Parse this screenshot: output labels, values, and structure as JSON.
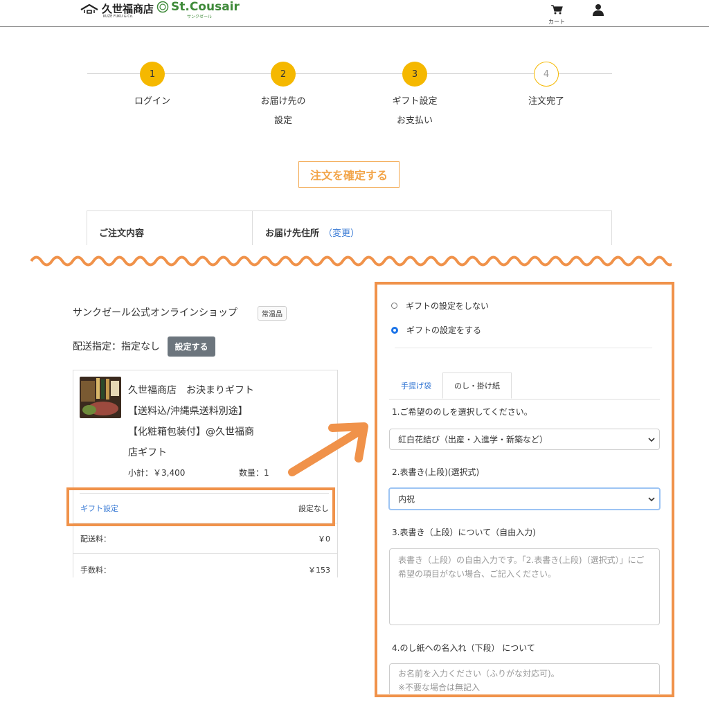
{
  "header": {
    "brand1": "久世福商店",
    "brand1_sub": "KUZE FUKU & Co.",
    "brand2": "St.Cousair",
    "brand2_sub": "サンクゼール",
    "cart_label": "カート"
  },
  "steps": [
    {
      "num": "1",
      "line1": "ログイン",
      "line2": ""
    },
    {
      "num": "2",
      "line1": "お届け先の",
      "line2": "設定"
    },
    {
      "num": "3",
      "line1": "ギフト設定",
      "line2": "お支払い"
    },
    {
      "num": "4",
      "line1": "注文完了",
      "line2": ""
    }
  ],
  "confirm_button": "注文を確定する",
  "summary": {
    "left_heading": "ご注文内容",
    "right_heading": "お届け先住所",
    "right_link": "（変更）"
  },
  "order": {
    "shop_name": "サンクゼール公式オンラインショップ",
    "badge": "常温品",
    "delivery_label": "配送指定：指定なし",
    "delivery_button": "設定する",
    "product_lines": [
      "久世福商店　お決まりギフト",
      "【送料込/沖縄県送料別途】",
      "【化粧箱包装付】@久世福商",
      "店ギフト"
    ],
    "subtotal": "小計：￥3,400",
    "quantity": "数量：1",
    "gift_label": "ギフト設定",
    "gift_value": "設定なし",
    "shipping_label": "配送料：",
    "shipping_value": "￥0",
    "fee_label": "手数料：",
    "fee_value": "￥153"
  },
  "gift_panel": {
    "radio_off": "ギフトの設定をしない",
    "radio_on": "ギフトの設定をする",
    "tab1": "手提げ袋",
    "tab2": "のし・掛け紙",
    "q1": "1.ご希望ののしを選択してください。",
    "q1_value": "紅白花結び（出産・入進学・新築など）",
    "q2": "2.表書き(上段)(選択式)",
    "q2_value": "内祝",
    "q3": "3.表書き（上段）について（自由入力)",
    "q3_placeholder": "表書き（上段）の自由入力です。「2.表書き(上段)（選択式）」にご希望の項目がない場合、ご記入ください。",
    "q4": "4.のし紙への名入れ（下段） について",
    "q4_placeholder_1": "お名前を入力ください（ふりがな対応可)。",
    "q4_placeholder_2": "※不要な場合は無記入"
  },
  "colors": {
    "step_active": "#f5b800",
    "accent_orange": "#f0924a",
    "link_blue": "#3a7bd5",
    "brand_green": "#3f8a3a"
  }
}
